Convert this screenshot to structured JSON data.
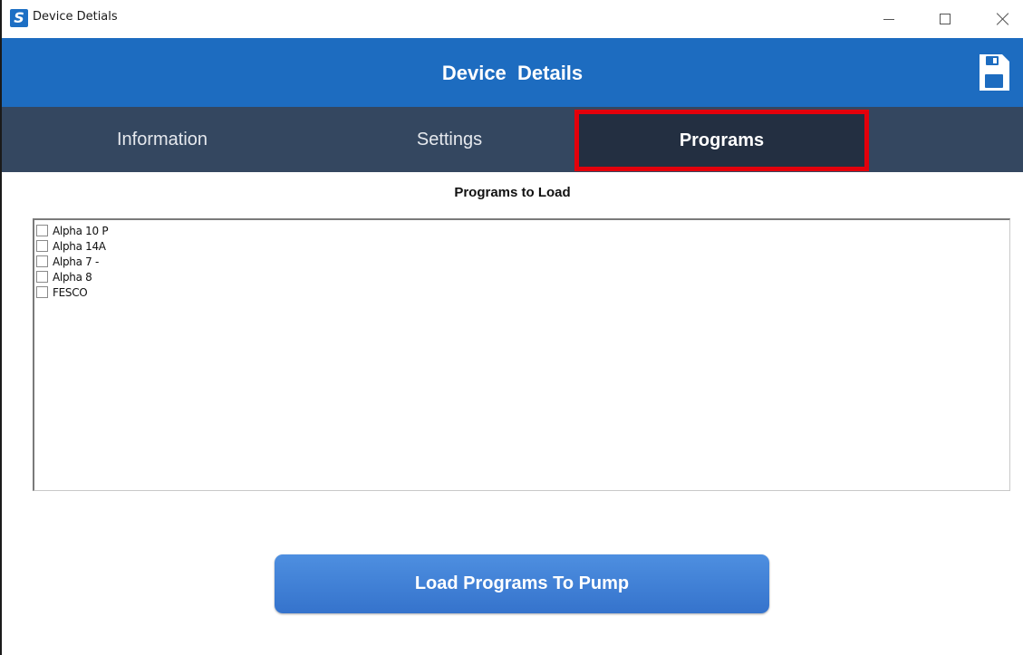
{
  "window": {
    "title": "Device Detials",
    "app_icon_letter": "S",
    "icons": [
      "minimize-icon",
      "maximize-icon",
      "close-icon"
    ]
  },
  "header": {
    "title": "Device  Details",
    "save_icon": "save-icon",
    "color": "#1d6cc0"
  },
  "tabs": [
    {
      "label": "Information",
      "selected": false
    },
    {
      "label": "Settings",
      "selected": false
    },
    {
      "label": "Programs",
      "selected": true
    }
  ],
  "highlight_color": "#e3000b",
  "programs": {
    "title": "Programs to Load",
    "items": [
      {
        "label": "Alpha 10 P",
        "checked": false
      },
      {
        "label": "Alpha 14A",
        "checked": false
      },
      {
        "label": "Alpha 7 -",
        "checked": false
      },
      {
        "label": "Alpha 8",
        "checked": false
      },
      {
        "label": "FESCO",
        "checked": false
      }
    ]
  },
  "actions": {
    "load_label": "Load Programs To Pump"
  }
}
